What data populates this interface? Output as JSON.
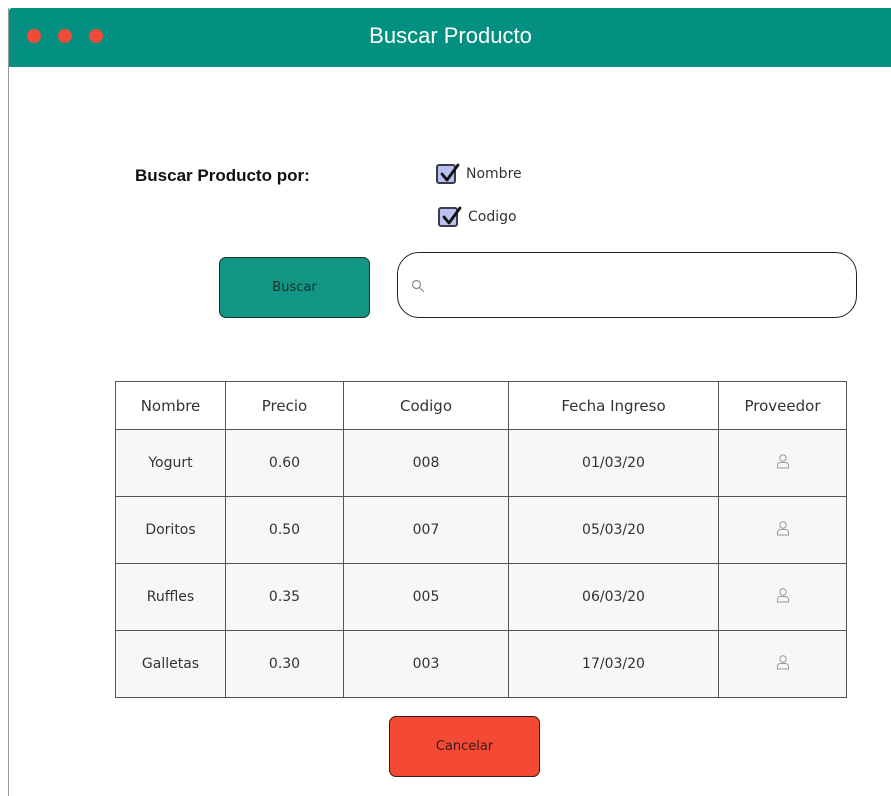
{
  "window": {
    "title": "Buscar Producto",
    "controls": [
      "close-dot",
      "minimize-dot",
      "maximize-dot"
    ]
  },
  "search": {
    "by_label": "Buscar Producto por:",
    "options": [
      {
        "label": "Nombre",
        "checked": true
      },
      {
        "label": "Codigo",
        "checked": true
      }
    ],
    "button_label": "Buscar",
    "input_value": "",
    "input_placeholder": "",
    "icon": "search-icon"
  },
  "table": {
    "headers": [
      "Nombre",
      "Precio",
      "Codigo",
      "Fecha Ingreso",
      "Proveedor"
    ],
    "rows": [
      {
        "nombre": "Yogurt",
        "precio": "0.60",
        "codigo": "008",
        "fecha": "01/03/20",
        "proveedor_icon": "user-icon"
      },
      {
        "nombre": "Doritos",
        "precio": "0.50",
        "codigo": "007",
        "fecha": "05/03/20",
        "proveedor_icon": "user-icon"
      },
      {
        "nombre": "Ruffles",
        "precio": "0.35",
        "codigo": "005",
        "fecha": "06/03/20",
        "proveedor_icon": "user-icon"
      },
      {
        "nombre": "Galletas",
        "precio": "0.30",
        "codigo": "003",
        "fecha": "17/03/20",
        "proveedor_icon": "user-icon"
      }
    ]
  },
  "actions": {
    "cancel_label": "Cancelar"
  },
  "colors": {
    "titlebar": "#049080",
    "buscar_button": "#109683",
    "cancel_button": "#f44a35",
    "window_dots": "#f04b3a",
    "checkbox_fill": "#b9c2ef"
  }
}
